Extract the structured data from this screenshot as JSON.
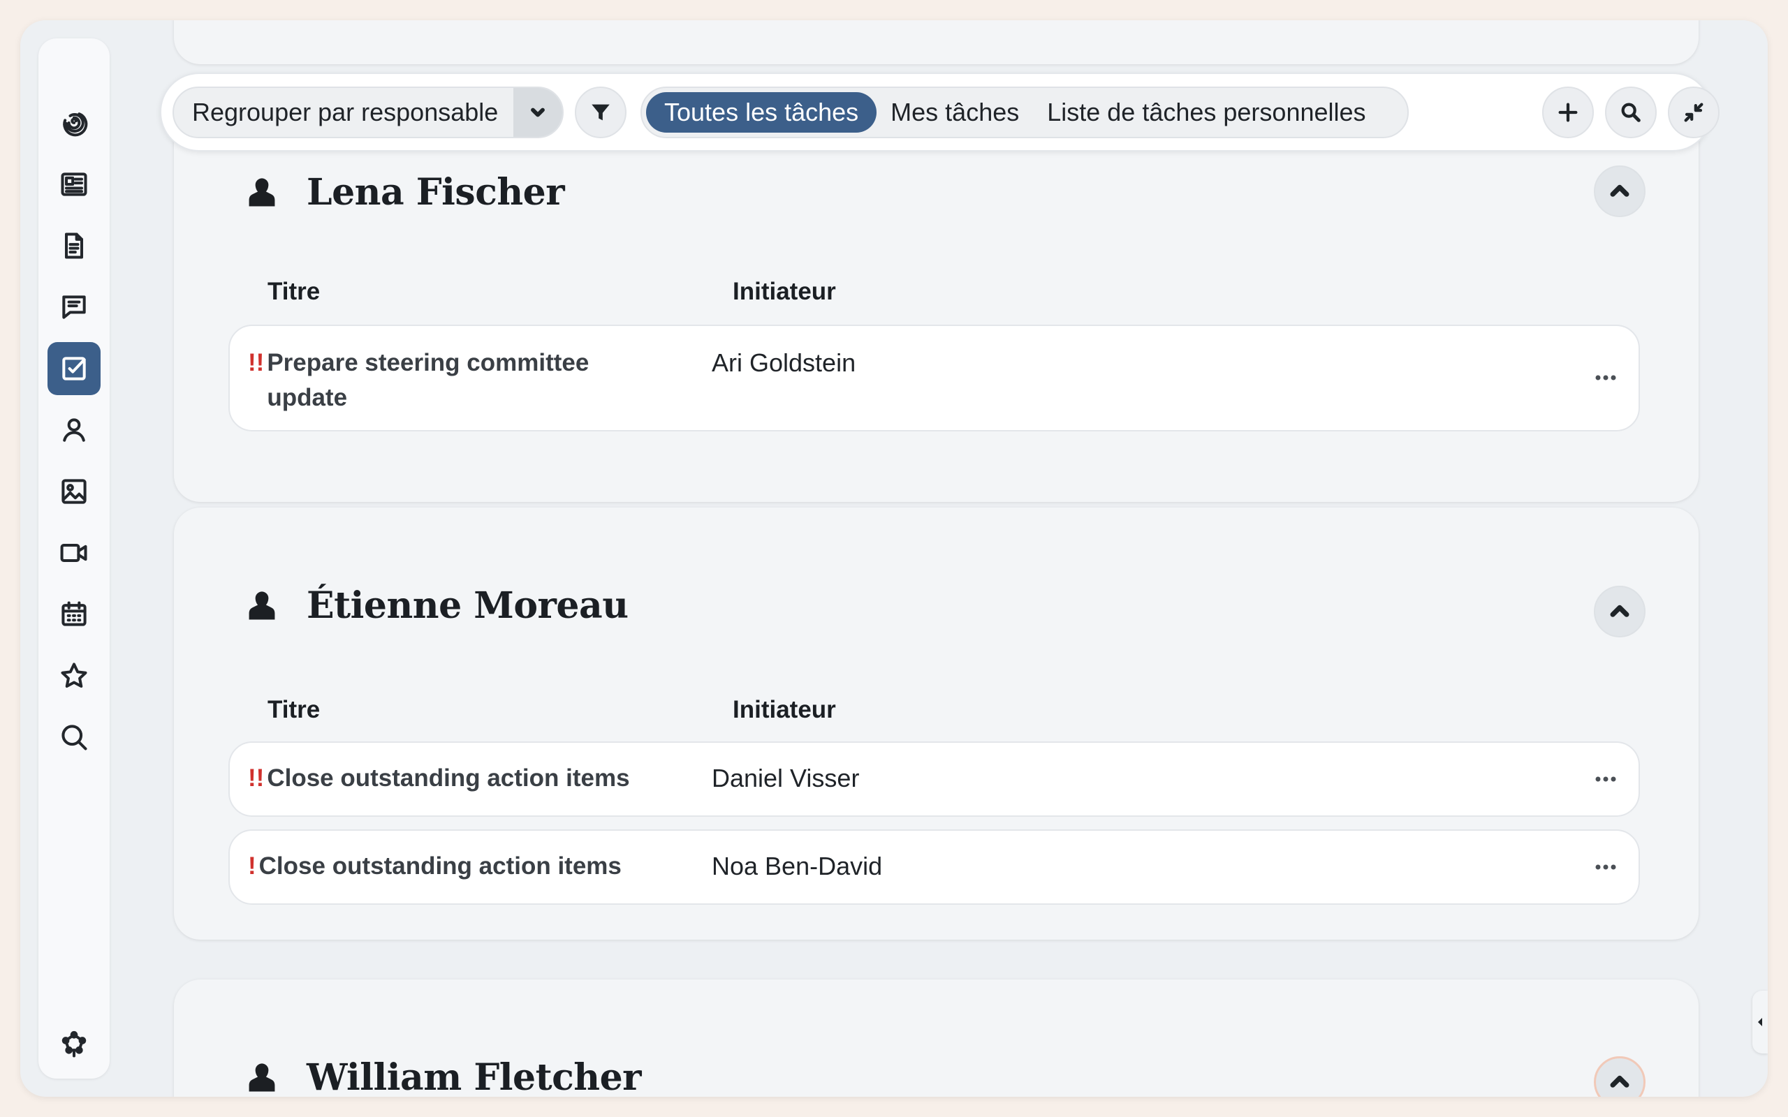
{
  "toolbar": {
    "group_by_label": "Regrouper par responsable",
    "tabs": [
      {
        "label": "Toutes les tâches",
        "active": true
      },
      {
        "label": "Mes tâches",
        "active": false
      },
      {
        "label": "Liste de tâches personnelles",
        "active": false
      }
    ]
  },
  "sidebar": {
    "items": [
      {
        "icon": "swirl-logo-icon"
      },
      {
        "icon": "newspaper-icon"
      },
      {
        "icon": "document-icon"
      },
      {
        "icon": "chat-icon"
      },
      {
        "icon": "tasks-checkbox-icon",
        "active": true
      },
      {
        "icon": "user-icon"
      },
      {
        "icon": "image-icon"
      },
      {
        "icon": "video-icon"
      },
      {
        "icon": "calendar-icon"
      },
      {
        "icon": "star-icon"
      },
      {
        "icon": "search-icon"
      },
      {
        "icon": "settings-network-icon"
      }
    ]
  },
  "columns": {
    "title": "Titre",
    "initiator": "Initiateur"
  },
  "groups": [
    {
      "name": "Lena Fischer",
      "tasks": [
        {
          "priority": "!!",
          "title": "Prepare steering committee update",
          "title_line1": "Prepare steering committee",
          "title_line2": "update",
          "initiator": "Ari Goldstein"
        }
      ]
    },
    {
      "name": "Étienne Moreau",
      "tasks": [
        {
          "priority": "!!",
          "title": "Close outstanding action items",
          "initiator": "Daniel Visser"
        },
        {
          "priority": "!",
          "title": "Close outstanding action items",
          "initiator": "Noa Ben-David"
        }
      ]
    },
    {
      "name": "William Fletcher",
      "tasks": []
    }
  ],
  "colors": {
    "accent": "#3c5f8a",
    "priority": "#d0312d",
    "background": "#f7efe9"
  }
}
